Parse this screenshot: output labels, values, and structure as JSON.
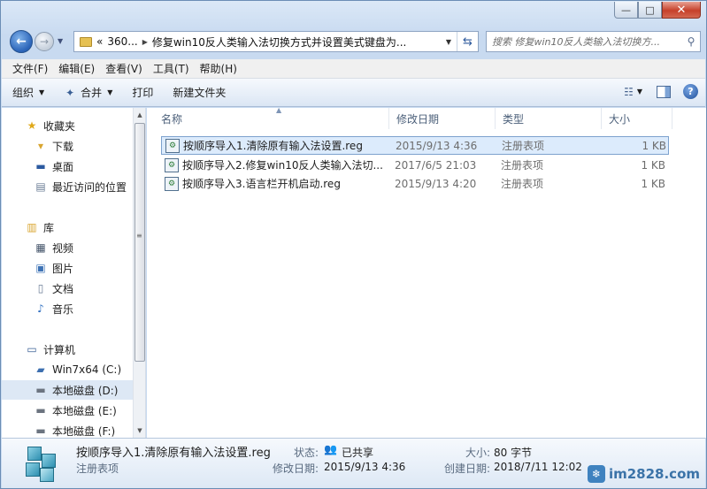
{
  "window": {
    "caption_buttons": {
      "minimize": "—",
      "maximize": "□",
      "close": "✕"
    }
  },
  "nav": {
    "back_icon": "back-arrow-icon",
    "forward_icon": "forward-arrow-icon",
    "address": {
      "prefix": "«",
      "segments": [
        "360...",
        "修复win10反人类输入法切换方式并设置美式键盘为..."
      ]
    },
    "search_placeholder": "搜索 修复win10反人类输入法切换方..."
  },
  "menubar": [
    "文件(F)",
    "编辑(E)",
    "查看(V)",
    "工具(T)",
    "帮助(H)"
  ],
  "toolbar": {
    "organize": "组织",
    "merge": "合并",
    "print": "打印",
    "new_folder": "新建文件夹"
  },
  "navpane": {
    "favorites_header": "收藏夹",
    "favorites": [
      "下载",
      "桌面",
      "最近访问的位置"
    ],
    "libraries_header": "库",
    "libraries": [
      "视频",
      "图片",
      "文档",
      "音乐"
    ],
    "computer_header": "计算机",
    "drives": [
      "Win7x64 (C:)",
      "本地磁盘 (D:)",
      "本地磁盘 (E:)",
      "本地磁盘 (F:)"
    ],
    "selected_drive": "本地磁盘 (D:)"
  },
  "filelist": {
    "columns": [
      "名称",
      "修改日期",
      "类型",
      "大小"
    ],
    "rows": [
      {
        "name": "按顺序导入1.清除原有输入法设置.reg",
        "date": "2015/9/13 4:36",
        "type": "注册表项",
        "size": "1 KB",
        "selected": true
      },
      {
        "name": "按顺序导入2.修复win10反人类输入法切...",
        "date": "2017/6/5 21:03",
        "type": "注册表项",
        "size": "1 KB",
        "selected": false
      },
      {
        "name": "按顺序导入3.语言栏开机启动.reg",
        "date": "2015/9/13 4:20",
        "type": "注册表项",
        "size": "1 KB",
        "selected": false
      }
    ]
  },
  "details": {
    "filename": "按顺序导入1.清除原有输入法设置.reg",
    "filetype": "注册表项",
    "status_label": "状态:",
    "status_value": "已共享",
    "modified_label": "修改日期:",
    "modified_value": "2015/9/13 4:36",
    "size_label": "大小:",
    "size_value": "80 字节",
    "created_label": "创建日期:",
    "created_value": "2018/7/11 12:02"
  },
  "watermark": "im2828.com"
}
